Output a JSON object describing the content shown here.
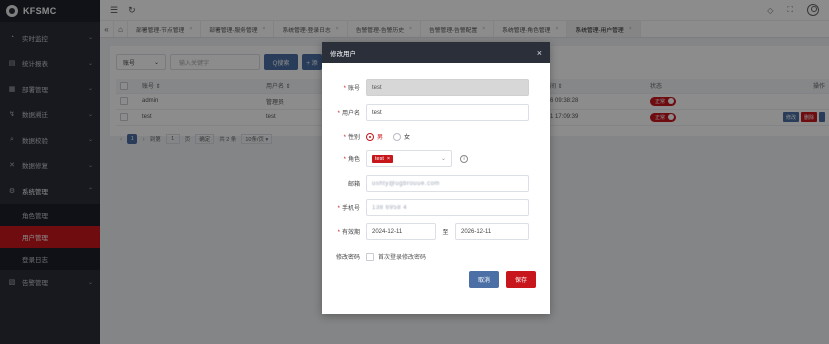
{
  "app": {
    "brand": "KFSMC"
  },
  "sidebar": {
    "items": [
      {
        "label": "实时监控",
        "icon": "monitor-icon",
        "glyph": "◔"
      },
      {
        "label": "统计报表",
        "icon": "report-icon",
        "glyph": "▤"
      },
      {
        "label": "部署管理",
        "icon": "deploy-icon",
        "glyph": "▦"
      },
      {
        "label": "数据溯迁",
        "icon": "trace-icon",
        "glyph": "↯"
      },
      {
        "label": "数据校验",
        "icon": "verify-icon",
        "glyph": "⌕"
      },
      {
        "label": "数据修复",
        "icon": "repair-icon",
        "glyph": "✕"
      },
      {
        "label": "系统管理",
        "icon": "gear-icon",
        "glyph": "⚙"
      }
    ],
    "submenu": [
      {
        "label": "角色管理"
      },
      {
        "label": "用户管理"
      },
      {
        "label": "登录日志"
      }
    ],
    "last": {
      "label": "告警管理",
      "icon": "alarm-icon",
      "glyph": "▧"
    }
  },
  "topbar": {
    "menu_glyph": "☰",
    "refresh_glyph": "↻"
  },
  "tabs": [
    {
      "label": "部署管理-节点管理"
    },
    {
      "label": "部署管理-服务管理"
    },
    {
      "label": "系统管理-登录日志"
    },
    {
      "label": "告警管理-告警历史"
    },
    {
      "label": "告警管理-告警配置"
    },
    {
      "label": "系统管理-角色管理"
    },
    {
      "label": "系统管理-用户管理"
    }
  ],
  "filter": {
    "field_value": "账号",
    "keyword_placeholder": "输入关键字",
    "search_label": "Q搜索",
    "add_label": "+ 添"
  },
  "table": {
    "headers": {
      "account": "账号 ⇕",
      "username": "用户名 ⇕",
      "time": "间 ⇕",
      "status": "状态",
      "ops": "操作"
    },
    "rows": [
      {
        "account": "admin",
        "username": "管理员",
        "time": "6 09:38:28",
        "status": "正常"
      },
      {
        "account": "test",
        "username": "test",
        "time": "1 17:09:39",
        "status": "正常"
      }
    ],
    "op_edit": "修改",
    "op_delete": "删除"
  },
  "pager": {
    "page": "1",
    "goto_label": "到第",
    "page_input": "1",
    "page_unit": "页",
    "confirm": "确定",
    "total": "共 2 条",
    "page_size": "10条/页 ▾"
  },
  "modal": {
    "title": "修改用户",
    "account_label": "账号",
    "account_value": "test",
    "username_label": "用户名",
    "username_value": "test",
    "gender_label": "性别",
    "gender_male": "男",
    "gender_female": "女",
    "role_label": "角色",
    "role_tag": "test",
    "email_label": "邮箱",
    "email_value": "ushty@ugbrouue.com",
    "phone_label": "手机号",
    "phone_value": "138 6958 4",
    "validity_label": "有效期",
    "validity_start": "2024-12-11",
    "validity_sep": "至",
    "validity_end": "2026-12-11",
    "password_label": "修改密码",
    "password_option": "首次登录修改密码",
    "cancel_label": "取消",
    "save_label": "保存"
  },
  "colors": {
    "brand_red": "#c8161d",
    "primary_blue": "#4c6fa5",
    "sidebar_bg": "#2b2f3a"
  }
}
